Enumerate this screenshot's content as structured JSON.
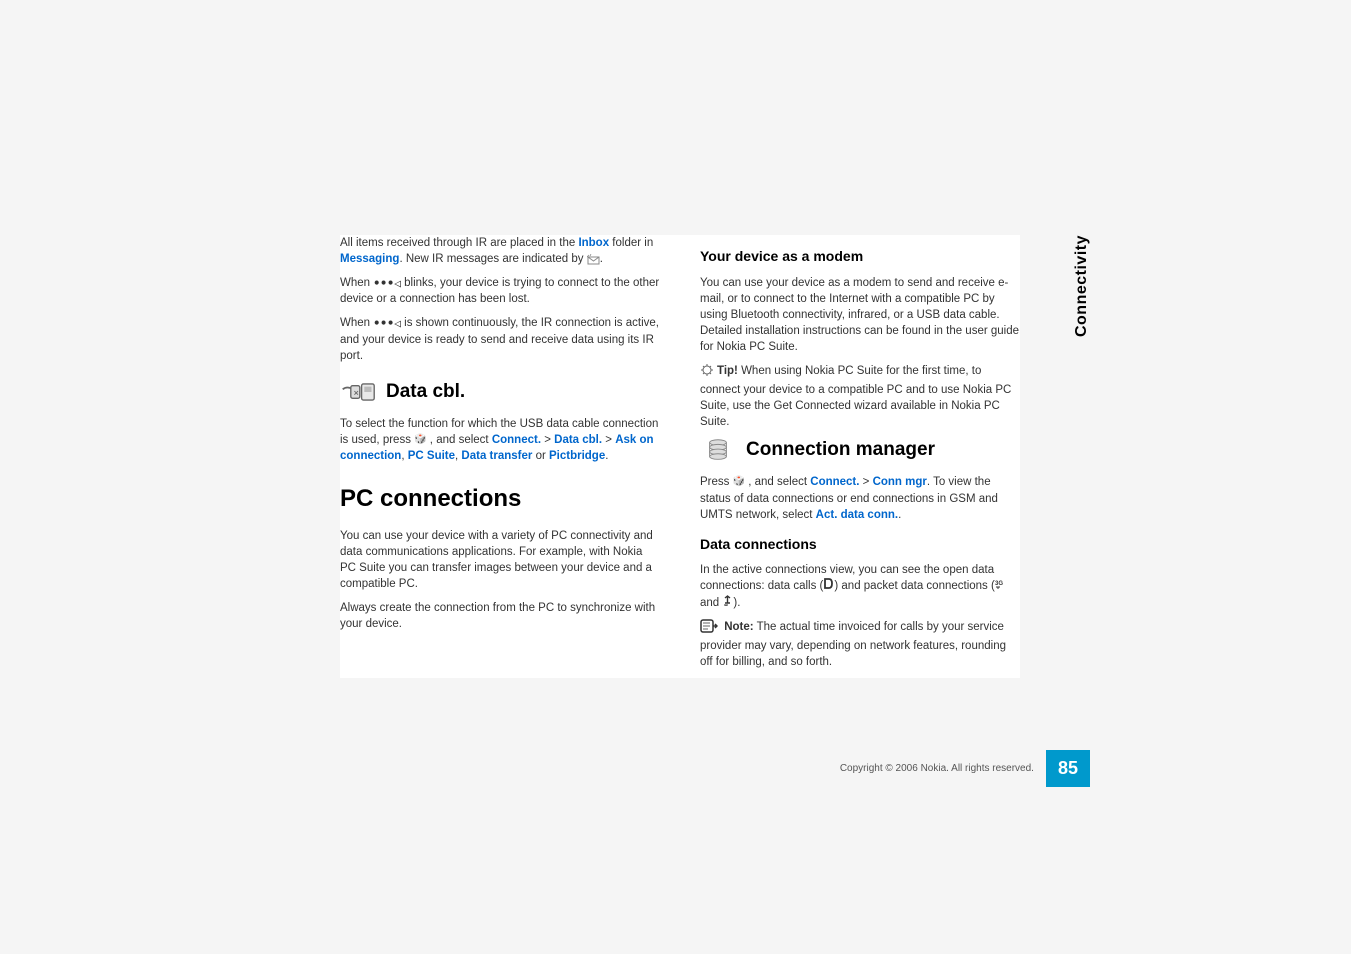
{
  "sideTab": "Connectivity",
  "pageNumber": "85",
  "copyright": "Copyright © 2006 Nokia. All rights reserved.",
  "left": {
    "p1_a": "All items received through IR are placed in the ",
    "p1_inbox": "Inbox",
    "p1_b": " folder in ",
    "p1_messaging": "Messaging",
    "p1_c": ". New IR messages are indicated by ",
    "p1_d": ".",
    "p2_a": "When ",
    "p2_b": " blinks, your device is trying to connect to the other device or a connection has been lost.",
    "p3_a": "When ",
    "p3_b": " is shown continuously, the IR connection is active, and your device is ready to send and receive data using its IR port.",
    "h_datacbl": "Data cbl.",
    "p4_a": "To select the function for which the USB data cable connection is used, press ",
    "p4_b": " , and select  ",
    "p4_connect": "Connect.",
    "p4_gt1": " > ",
    "p4_datacbl": "Data cbl.",
    "p4_gt2": " > ",
    "p4_ask": "Ask on connection",
    "p4_c": ",  ",
    "p4_pcsuite": "PC Suite",
    "p4_d": ", ",
    "p4_datatransfer": "Data transfer",
    "p4_e": " or ",
    "p4_pictbridge": "Pictbridge",
    "p4_f": ".",
    "h_pcconn": "PC connections",
    "p5": "You can use your device with a variety of PC connectivity and data communications applications. For example, with Nokia PC Suite you can transfer images between your device and a compatible PC.",
    "p6": "Always create the connection from the PC to synchronize with your device."
  },
  "right": {
    "h_modem": "Your device as a modem",
    "p1": "You can use your device as a modem to send and receive e-mail, or to connect to the Internet with a compatible PC by using Bluetooth connectivity, infrared, or a USB data cable. Detailed installation instructions can be found in the user guide for Nokia PC Suite.",
    "tip_label": "Tip!",
    "tip_text": " When using Nokia PC Suite for the first time, to connect your device to a compatible PC and to use Nokia PC Suite, use the Get Connected wizard available in Nokia PC Suite.",
    "h_connmgr": "Connection manager",
    "p2_a": "Press ",
    "p2_b": " , and select ",
    "p2_connect": "Connect.",
    "p2_gt": " > ",
    "p2_connmgr": "Conn mgr",
    "p2_c": ". To view the status of data connections or end connections in GSM and UMTS network, select ",
    "p2_actdata": "Act. data conn.",
    "p2_d": ".",
    "h_dataconn": "Data connections",
    "p3_a": "In the active connections view, you can see the open data connections: data calls (",
    "p3_b": ") and packet data connections (",
    "p3_c": " and ",
    "p3_d": ").",
    "note_label": "Note:",
    "note_text": " The actual time invoiced for calls by your service provider may vary, depending on network features, rounding off for billing, and so forth."
  }
}
